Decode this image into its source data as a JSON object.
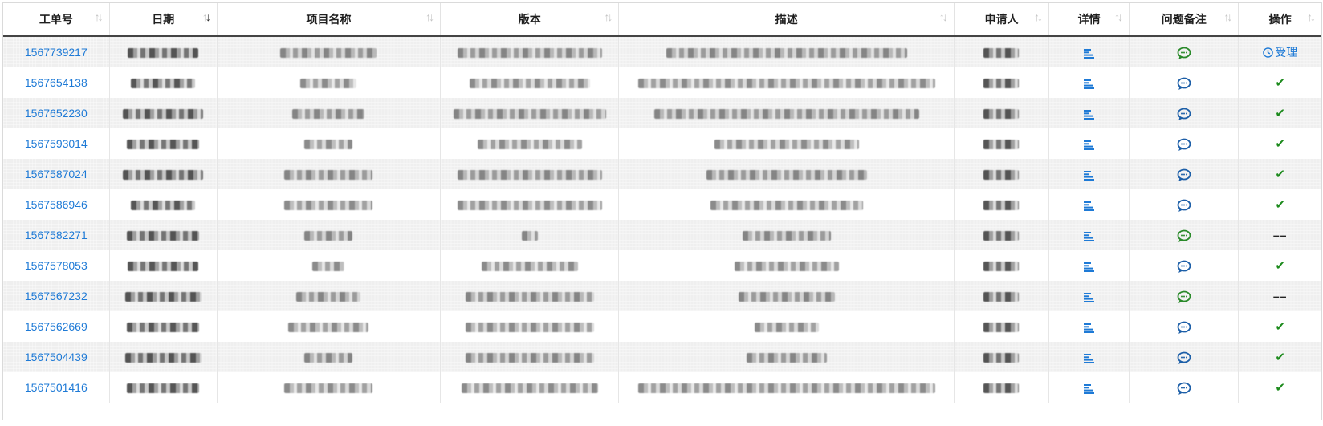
{
  "columns": [
    {
      "label": "工单号",
      "sort": "none"
    },
    {
      "label": "日期",
      "sort": "desc"
    },
    {
      "label": "项目名称",
      "sort": "none"
    },
    {
      "label": "版本",
      "sort": "none"
    },
    {
      "label": "描述",
      "sort": "none"
    },
    {
      "label": "申请人",
      "sort": "none"
    },
    {
      "label": "详情",
      "sort": "none"
    },
    {
      "label": "问题备注",
      "sort": "none"
    },
    {
      "label": "操作",
      "sort": "none"
    }
  ],
  "colors": {
    "link": "#1e7ad6",
    "chat_blue": "#1d5fa8",
    "chat_green": "#2a8a2a",
    "check": "#1c8a1c"
  },
  "icons": {
    "sort": "sort-arrows-icon",
    "detail": "detail-lines-icon",
    "chat": "chat-bubble-icon",
    "check": "check-icon",
    "clock": "clock-icon"
  },
  "rows": [
    {
      "id": "1567739217",
      "chat": "green",
      "action": "accept",
      "action_label": "受理"
    },
    {
      "id": "1567654138",
      "chat": "blue",
      "action": "check"
    },
    {
      "id": "1567652230",
      "chat": "blue",
      "action": "check"
    },
    {
      "id": "1567593014",
      "chat": "blue",
      "action": "check"
    },
    {
      "id": "1567587024",
      "chat": "blue",
      "action": "check"
    },
    {
      "id": "1567586946",
      "chat": "blue",
      "action": "check"
    },
    {
      "id": "1567582271",
      "chat": "green",
      "action": "dash",
      "action_label": "––"
    },
    {
      "id": "1567578053",
      "chat": "blue",
      "action": "check"
    },
    {
      "id": "1567567232",
      "chat": "green",
      "action": "dash",
      "action_label": "––"
    },
    {
      "id": "1567562669",
      "chat": "blue",
      "action": "check"
    },
    {
      "id": "1567504439",
      "chat": "blue",
      "action": "check"
    },
    {
      "id": "1567501416",
      "chat": "blue",
      "action": "check"
    }
  ]
}
